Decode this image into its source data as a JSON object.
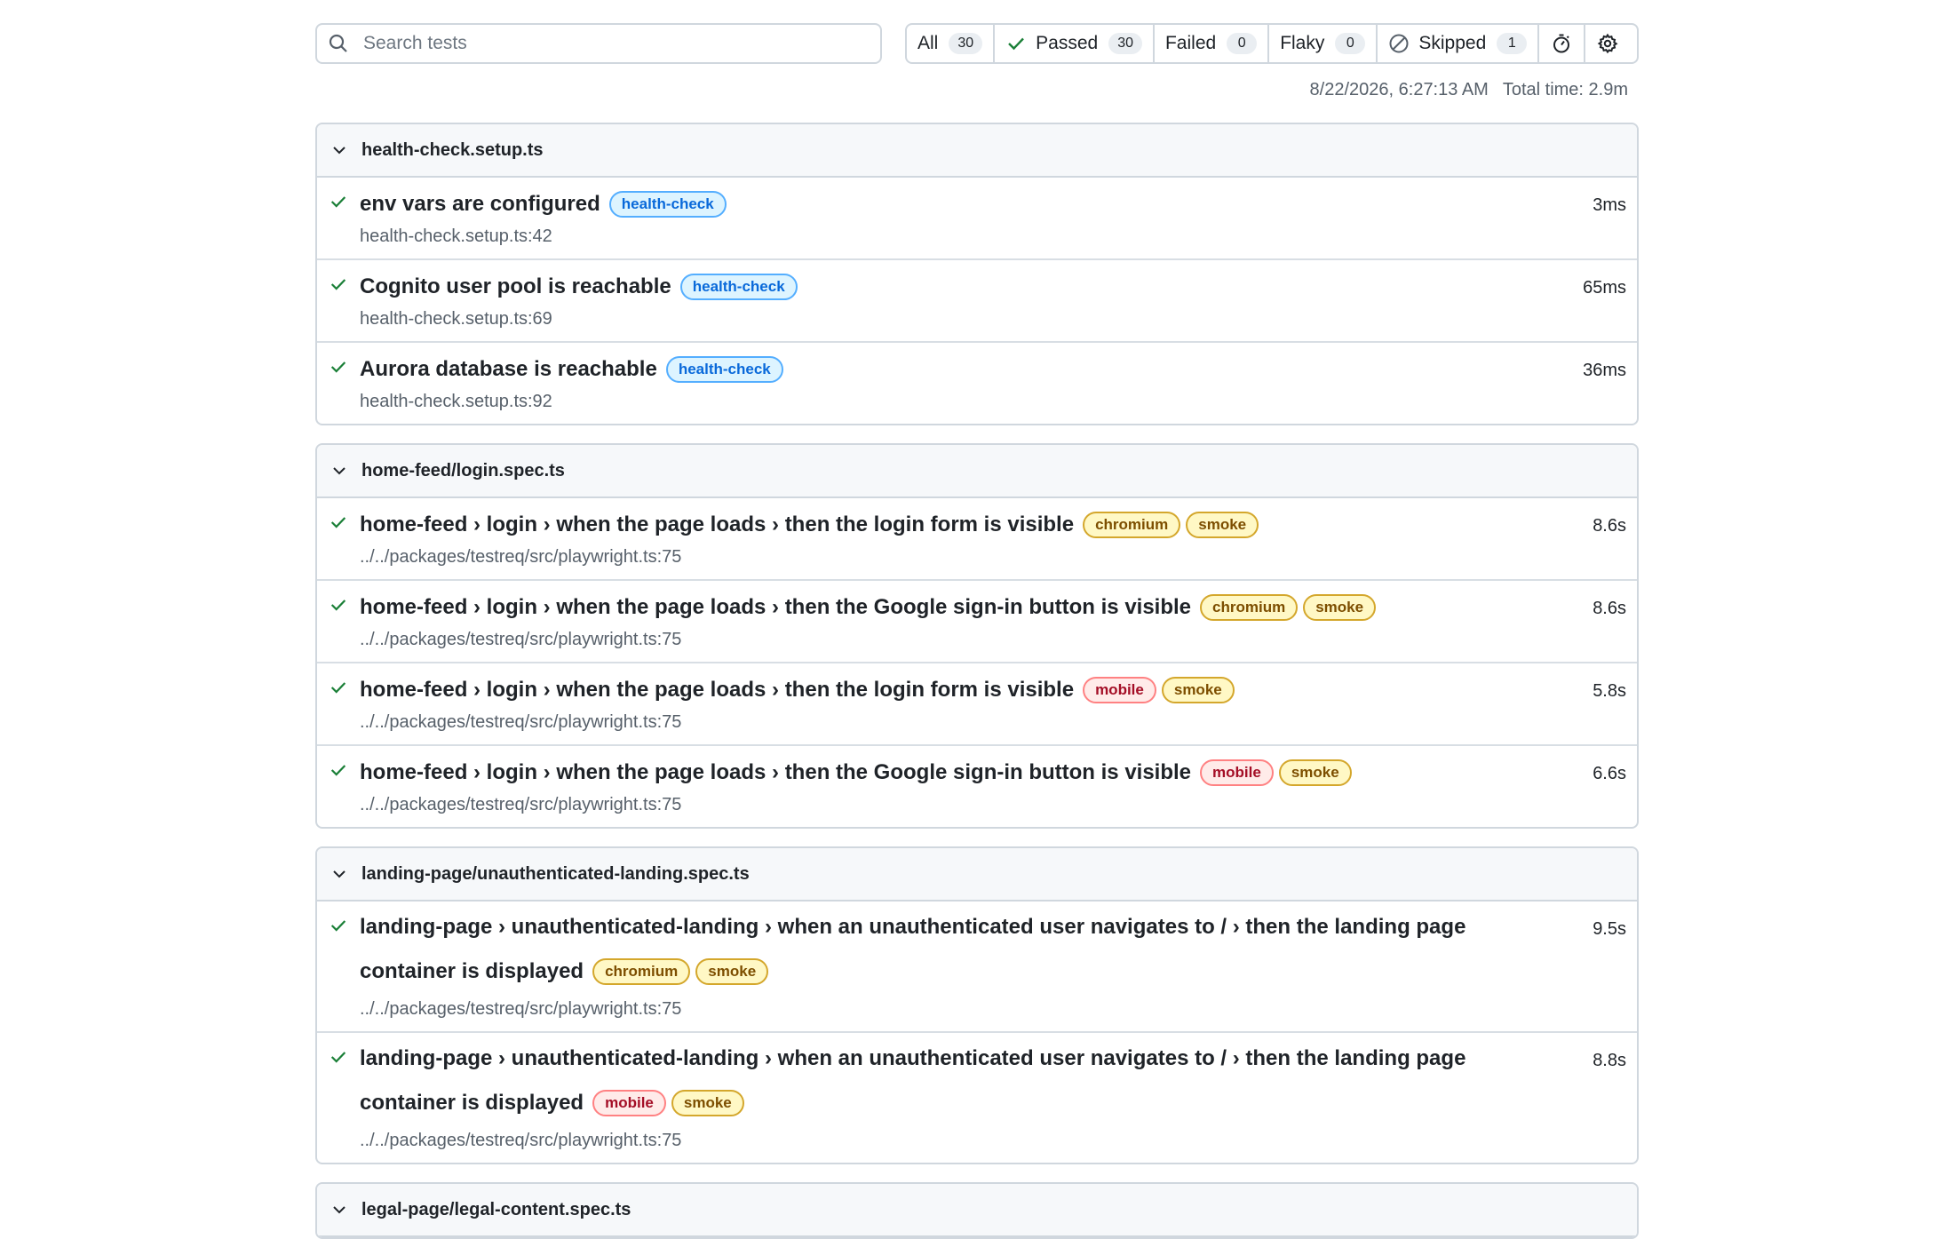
{
  "search": {
    "placeholder": "Search tests",
    "value": ""
  },
  "filters": [
    {
      "label": "All",
      "count": "30"
    },
    {
      "label": "Passed",
      "count": "30",
      "icon": "check-icon"
    },
    {
      "label": "Failed",
      "count": "0"
    },
    {
      "label": "Flaky",
      "count": "0"
    },
    {
      "label": "Skipped",
      "count": "1",
      "icon": "skip-icon"
    }
  ],
  "meta": {
    "timestamp": "8/22/2026, 6:27:13 AM",
    "total_time": "Total time: 2.9m"
  },
  "groups": [
    {
      "file": "health-check.setup.ts",
      "tests": [
        {
          "title": "env vars are configured",
          "tags": [
            "health-check"
          ],
          "location": "health-check.setup.ts:42",
          "duration": "3ms"
        },
        {
          "title": "Cognito user pool is reachable",
          "tags": [
            "health-check"
          ],
          "location": "health-check.setup.ts:69",
          "duration": "65ms"
        },
        {
          "title": "Aurora database is reachable",
          "tags": [
            "health-check"
          ],
          "location": "health-check.setup.ts:92",
          "duration": "36ms"
        }
      ]
    },
    {
      "file": "home-feed/login.spec.ts",
      "tests": [
        {
          "title": "home-feed › login › when the page loads › then the login form is visible",
          "tags": [
            "chromium",
            "smoke"
          ],
          "location": "../../packages/testreq/src/playwright.ts:75",
          "duration": "8.6s"
        },
        {
          "title": "home-feed › login › when the page loads › then the Google sign-in button is visible",
          "tags": [
            "chromium",
            "smoke"
          ],
          "location": "../../packages/testreq/src/playwright.ts:75",
          "duration": "8.6s"
        },
        {
          "title": "home-feed › login › when the page loads › then the login form is visible",
          "tags": [
            "mobile",
            "smoke"
          ],
          "location": "../../packages/testreq/src/playwright.ts:75",
          "duration": "5.8s"
        },
        {
          "title": "home-feed › login › when the page loads › then the Google sign-in button is visible",
          "tags": [
            "mobile",
            "smoke"
          ],
          "location": "../../packages/testreq/src/playwright.ts:75",
          "duration": "6.6s"
        }
      ]
    },
    {
      "file": "landing-page/unauthenticated-landing.spec.ts",
      "tests": [
        {
          "title": "landing-page › unauthenticated-landing › when an unauthenticated user navigates to / › then the landing page container is displayed",
          "tags": [
            "chromium",
            "smoke"
          ],
          "location": "../../packages/testreq/src/playwright.ts:75",
          "duration": "9.5s"
        },
        {
          "title": "landing-page › unauthenticated-landing › when an unauthenticated user navigates to / › then the landing page container is displayed",
          "tags": [
            "mobile",
            "smoke"
          ],
          "location": "../../packages/testreq/src/playwright.ts:75",
          "duration": "8.8s"
        }
      ]
    },
    {
      "file": "legal-page/legal-content.spec.ts",
      "tests": []
    }
  ],
  "colors": {
    "pass": "#1a7f37",
    "border": "#d0d7de",
    "header_bg": "#f6f8fa"
  }
}
